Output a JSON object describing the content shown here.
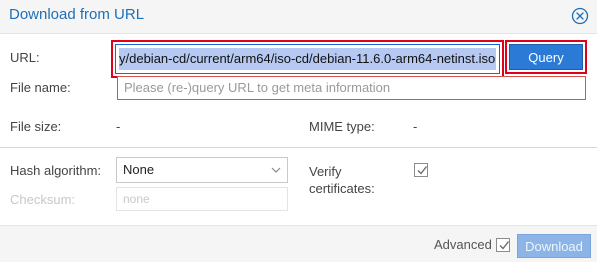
{
  "dialog": {
    "title": "Download from URL"
  },
  "form": {
    "url_label": "URL:",
    "url_value": "y/debian-cd/current/arm64/iso-cd/debian-11.6.0-arm64-netinst.iso",
    "query_button": "Query URL",
    "filename_label": "File name:",
    "filename_placeholder": "Please (re-)query URL to get meta information",
    "filesize_label": "File size:",
    "filesize_value": "-",
    "mimetype_label": "MIME type:",
    "mimetype_value": "-",
    "hash_label": "Hash algorithm:",
    "hash_value": "None",
    "checksum_label": "Checksum:",
    "checksum_placeholder": "none",
    "verify_label_line1": "Verify",
    "verify_label_line2": "certificates:",
    "verify_checked": true
  },
  "footer": {
    "advanced_label": "Advanced",
    "advanced_checked": true,
    "download_button": "Download"
  },
  "colors": {
    "title": "#1e6fb7",
    "highlight": "#e0001a",
    "primary_button": "#2b7ad6",
    "disabled_button": "#8cb4e6",
    "selection": "#b5c9f2",
    "invalid_border": "#d9534f"
  }
}
